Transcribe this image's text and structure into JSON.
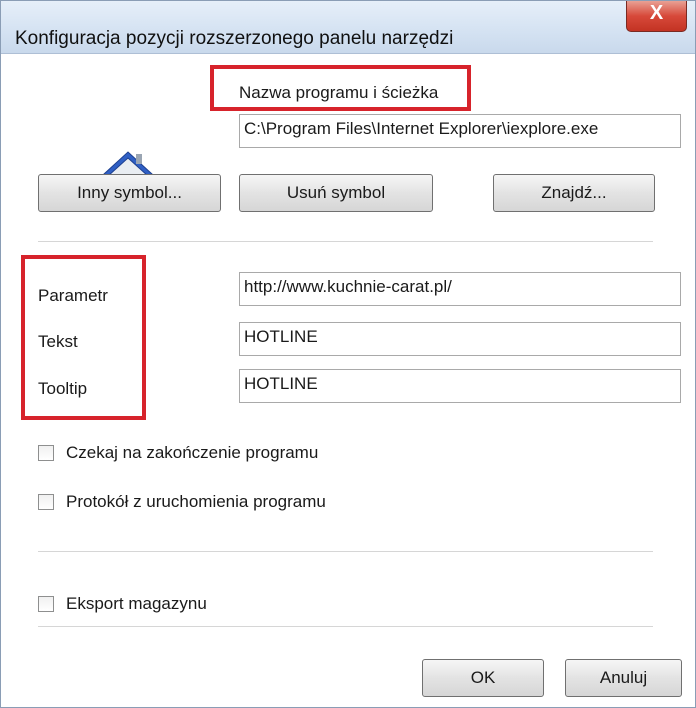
{
  "window": {
    "title": "Konfiguracja pozycji rozszerzonego panelu narzędzi",
    "close_label": "X"
  },
  "program": {
    "label": "Nazwa programu i ścieżka",
    "path_value": "C:\\Program Files\\Internet Explorer\\iexplore.exe",
    "icon": "house-icon"
  },
  "buttons": {
    "other_symbol": "Inny symbol...",
    "remove_symbol": "Usuń symbol",
    "find": "Znajdź...",
    "ok": "OK",
    "cancel": "Anuluj"
  },
  "fields": {
    "param_label": "Parametr",
    "param_value": "http://www.kuchnie-carat.pl/",
    "text_label": "Tekst",
    "text_value": "HOTLINE",
    "tooltip_label": "Tooltip",
    "tooltip_value": "HOTLINE"
  },
  "checkboxes": [
    {
      "label": "Czekaj na zakończenie programu",
      "checked": false
    },
    {
      "label": "Protokół z uruchomienia programu",
      "checked": false
    },
    {
      "label": "Eksport magazynu",
      "checked": false
    }
  ],
  "colors": {
    "highlight": "#d7232b",
    "close_button": "#c33323"
  }
}
